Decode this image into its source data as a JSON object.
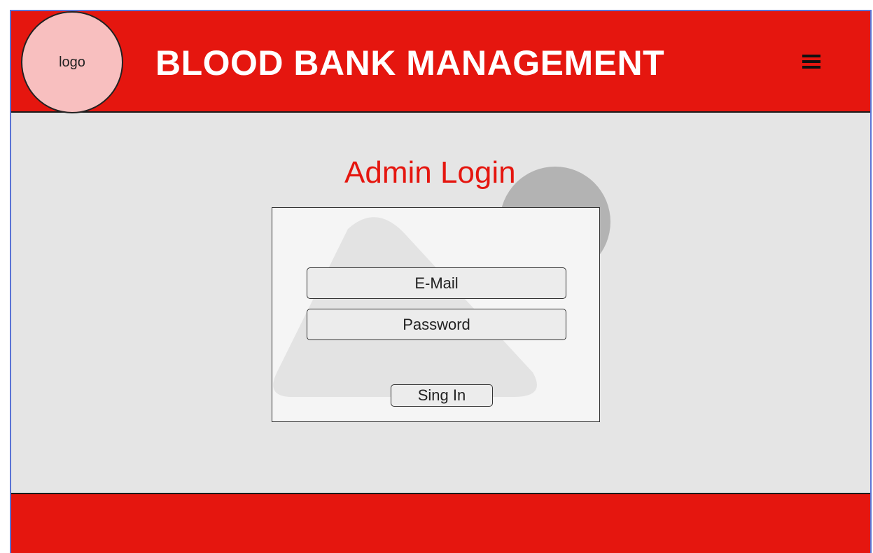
{
  "header": {
    "logo_label": "logo",
    "title": "BLOOD BANK MANAGEMENT",
    "menu_icon": "hamburger-menu-icon"
  },
  "main": {
    "heading": "Admin Login",
    "form": {
      "email_placeholder": "E-Mail",
      "email_value": "",
      "password_placeholder": "Password",
      "password_value": "",
      "submit_label": "Sing In"
    }
  },
  "colors": {
    "brand_red": "#e5160f",
    "logo_fill": "#f8bfbf",
    "content_bg": "#e5e5e5",
    "card_bg": "#f5f5f5"
  }
}
